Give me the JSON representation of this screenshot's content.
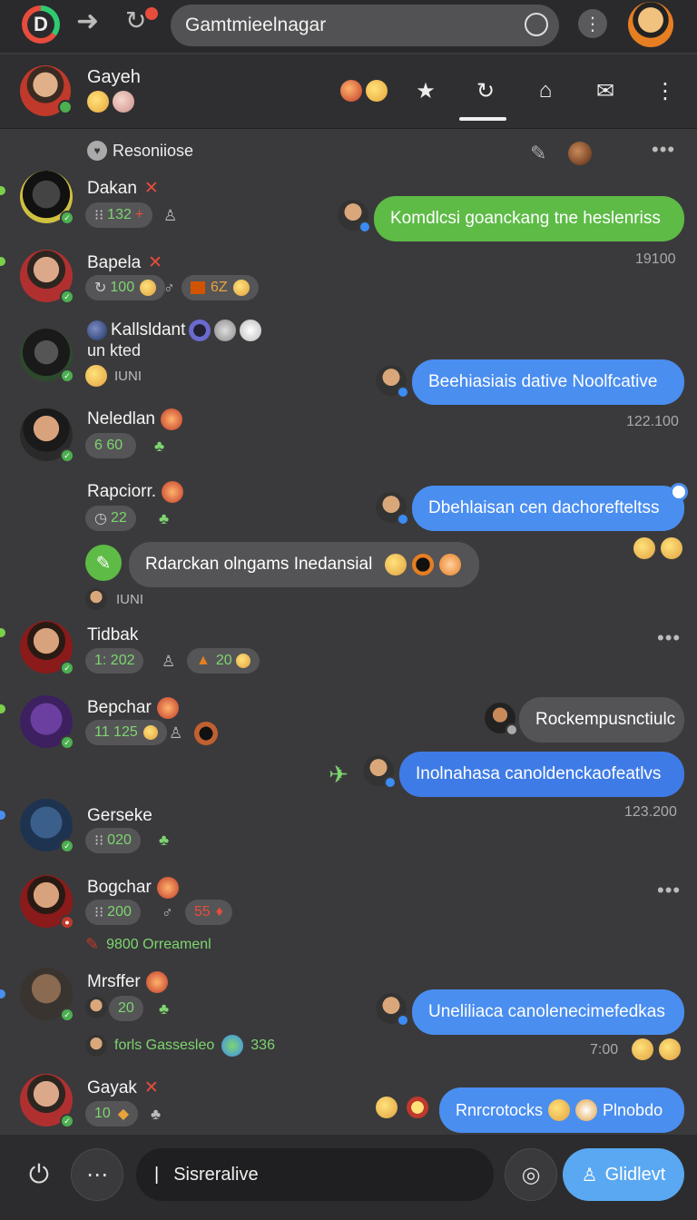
{
  "top_bar": {
    "address": "Gamtmieelnagar",
    "logo_letter": "D"
  },
  "chat_header": {
    "name": "Gayeh"
  },
  "section_label": "Resoniiose",
  "contacts": [
    {
      "name": "Dakan",
      "stat": "132",
      "stat_prefix": "⁝⁝"
    },
    {
      "name": "Bapela",
      "stat": "100",
      "stat2": "6Z"
    },
    {
      "name": "Kallsldant",
      "subline": "un kted",
      "status": "IUNI"
    },
    {
      "name": "Neledlan",
      "stat": "6 60"
    },
    {
      "name": "Rapciorr.",
      "stat": "22"
    },
    {
      "name": "Tidbak",
      "stat": "1: 202",
      "stat2": "20"
    },
    {
      "name": "Bepchar",
      "stat": "11 125"
    },
    {
      "name": "Gerseke",
      "stat": "020"
    },
    {
      "name": "Bogchar",
      "stat": "200",
      "stat2": "55",
      "note": "9800 Orreamenl"
    },
    {
      "name": "Mrsffer",
      "stat": "20",
      "note": "forls Gassesleo",
      "note_num": "336"
    },
    {
      "name": "Gayak",
      "stat": "10"
    }
  ],
  "messages": [
    {
      "text": "Komdlcsi goanckang tne heslenriss",
      "time": "19100"
    },
    {
      "text": "Beehiasiais dative Noolfcative",
      "time": "122.100"
    },
    {
      "text": "Dbehlaisan cen dachorefteltss"
    },
    {
      "text": "Rdarckan olngams Inedansial",
      "status": "IUNI"
    },
    {
      "text": "Rockempusnctiulc"
    },
    {
      "text": "Inolnahasa canoldenckaofeatlvs",
      "time": "123.200"
    },
    {
      "text": "Uneliliaca canolenecimefedkas",
      "time": "7:00"
    },
    {
      "text": "Rnrcrotocks",
      "text2": "Plnobdo"
    }
  ],
  "composer": {
    "input_text": "Sisreralive",
    "send_label": "Glidlevt"
  },
  "colors": {
    "bg": "#3a3a3c",
    "green_bubble": "#5dbb46",
    "blue_bubble": "#4a8ef0",
    "send_button": "#5aa8f2"
  }
}
